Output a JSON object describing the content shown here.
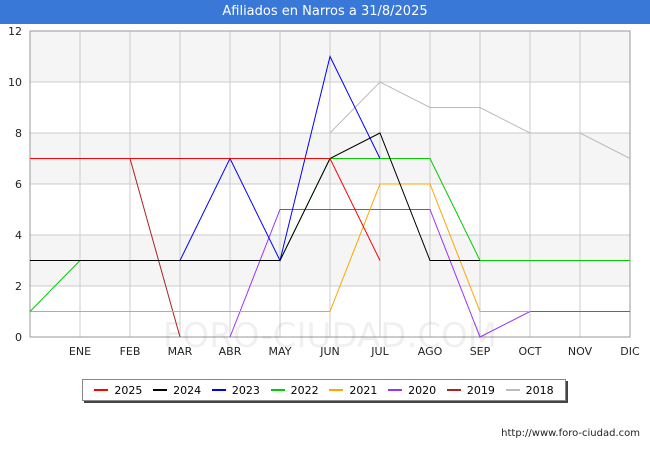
{
  "title": "Afiliados en Narros a 31/8/2025",
  "footer": "http://www.foro-ciudad.com",
  "watermark": "FORO-CIUDAD.COM",
  "chart_data": {
    "type": "line",
    "categories": [
      "ENE",
      "FEB",
      "MAR",
      "ABR",
      "MAY",
      "JUN",
      "JUL",
      "AGO",
      "SEP",
      "OCT",
      "NOV",
      "DIC"
    ],
    "ylim": [
      0,
      12
    ],
    "yticks": [
      0,
      2,
      4,
      6,
      8,
      10,
      12
    ],
    "grid": true,
    "legend_position": "bottom",
    "series": [
      {
        "name": "2025",
        "color": "#ff0000",
        "values": [
          7,
          7,
          7,
          7,
          7,
          7,
          7,
          3
        ]
      },
      {
        "name": "2024",
        "color": "#000000",
        "values": [
          3,
          3,
          3,
          3,
          3,
          3,
          7,
          8,
          3,
          3
        ]
      },
      {
        "name": "2023",
        "color": "#0000ff",
        "values": [
          3,
          3,
          3,
          3,
          7,
          3,
          11,
          7
        ]
      },
      {
        "name": "2022",
        "color": "#00cc00",
        "values": [
          1,
          3,
          3,
          3,
          3,
          3,
          7,
          7,
          7,
          3,
          3,
          3,
          3
        ]
      },
      {
        "name": "2021",
        "color": "#ffa500",
        "values": [
          1,
          1,
          1,
          1,
          1,
          1,
          1,
          6,
          6,
          1,
          1
        ]
      },
      {
        "name": "2020",
        "color": "#9933ff",
        "values": [
          null,
          null,
          null,
          null,
          0,
          5,
          5,
          5,
          5,
          0,
          1,
          1,
          1
        ]
      },
      {
        "name": "2019",
        "color": "#aa2222",
        "values": [
          7,
          7,
          7,
          0
        ]
      },
      {
        "name": "2018",
        "color": "#bbbbbb",
        "values": [
          null,
          null,
          null,
          null,
          null,
          null,
          8,
          10,
          9,
          9,
          8,
          8,
          7
        ]
      }
    ]
  }
}
